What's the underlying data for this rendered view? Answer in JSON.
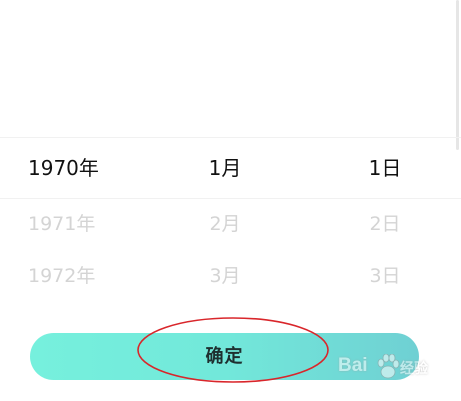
{
  "picker": {
    "year": {
      "selected": "1970年",
      "options": [
        "1971年",
        "1972年"
      ]
    },
    "month": {
      "selected": "1月",
      "options": [
        "2月",
        "3月"
      ]
    },
    "day": {
      "selected": "1日",
      "options": [
        "2日",
        "3日"
      ]
    }
  },
  "confirm": {
    "label": "确定",
    "gradient_start": "#76f0dd",
    "gradient_end": "#6fd0d3"
  },
  "annotation": {
    "shape": "ellipse",
    "color": "#d9262b"
  },
  "watermark": {
    "left_text": "Bai",
    "icon": "paw-icon",
    "right_text": "经验"
  }
}
